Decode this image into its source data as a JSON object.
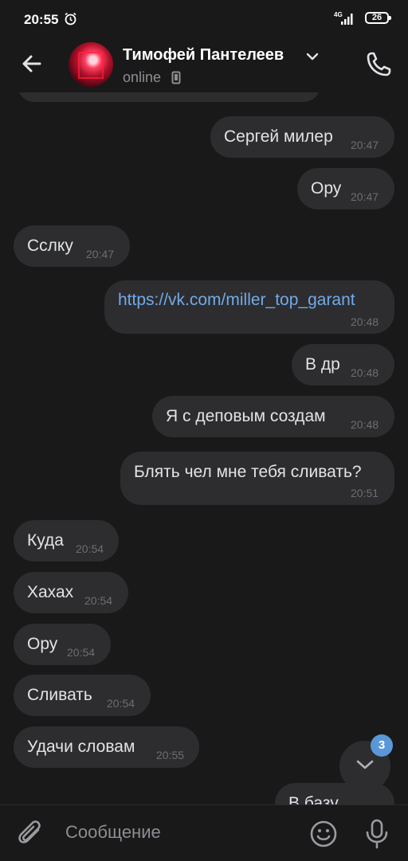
{
  "status_bar": {
    "time": "20:55",
    "network": "4G",
    "battery": "26"
  },
  "header": {
    "contact_name": "Тимофей Пантелеев",
    "status": "online"
  },
  "messages": [
    {
      "direction": "out",
      "text": "Сергей милер",
      "time": "20:47"
    },
    {
      "direction": "out",
      "text": "Ору",
      "time": "20:47"
    },
    {
      "direction": "in",
      "text": "Сслку",
      "time": "20:47"
    },
    {
      "direction": "out",
      "text": "https://vk.com/miller_top_garant",
      "time": "20:48",
      "is_link": true
    },
    {
      "direction": "out",
      "text": "В др",
      "time": "20:48"
    },
    {
      "direction": "out",
      "text": "Я с деповым создам",
      "time": "20:48"
    },
    {
      "direction": "out",
      "text": "Блять чел мне тебя сливать?",
      "time": "20:51"
    },
    {
      "direction": "in",
      "text": "Куда",
      "time": "20:54"
    },
    {
      "direction": "in",
      "text": "Хахах",
      "time": "20:54"
    },
    {
      "direction": "in",
      "text": "Ору",
      "time": "20:54"
    },
    {
      "direction": "in",
      "text": "Сливать",
      "time": "20:54"
    },
    {
      "direction": "in",
      "text": "Удачи словам",
      "time": "20:55"
    },
    {
      "direction": "out",
      "text": "В базу",
      "time": ""
    }
  ],
  "scroll_down": {
    "unread_count": "3"
  },
  "composer": {
    "placeholder": "Сообщение"
  },
  "colors": {
    "background": "#19191a",
    "bubble": "#2d2d2f",
    "link": "#71aaeb",
    "badge": "#5a97d8"
  },
  "icons": [
    "alarm-icon",
    "signal-icon",
    "battery-icon",
    "back-arrow-icon",
    "chevron-down-icon",
    "mobile-device-icon",
    "phone-icon",
    "attach-icon",
    "emoji-icon",
    "microphone-icon",
    "chevron-down-icon"
  ]
}
